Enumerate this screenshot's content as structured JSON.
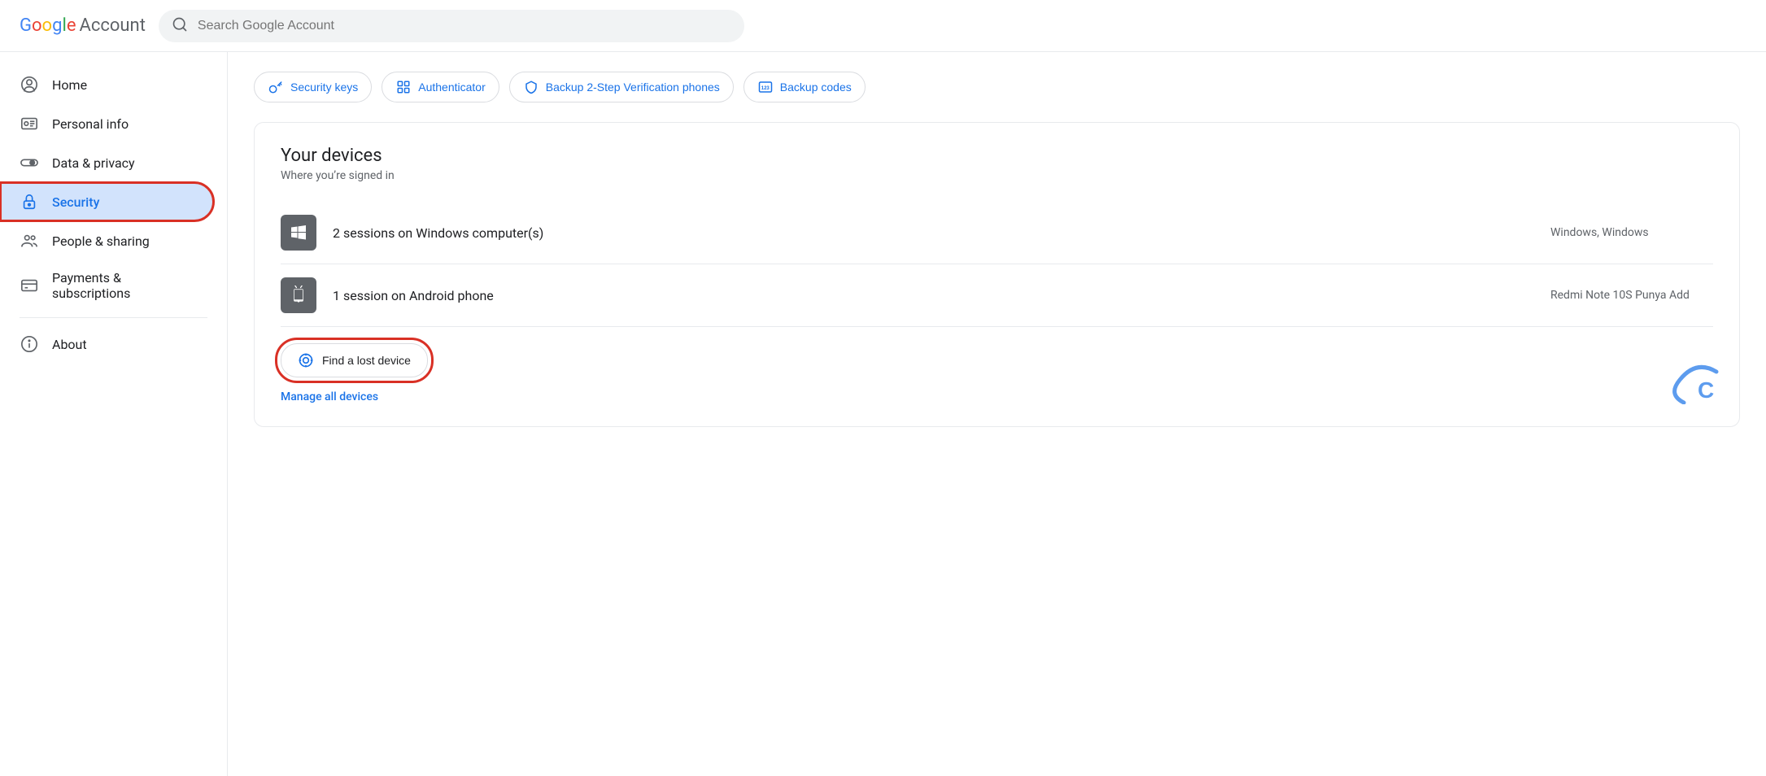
{
  "header": {
    "logo_google": "Google",
    "logo_account": "Account",
    "search_placeholder": "Search Google Account"
  },
  "sidebar": {
    "items": [
      {
        "id": "home",
        "label": "Home",
        "icon": "person-circle-icon"
      },
      {
        "id": "personal-info",
        "label": "Personal info",
        "icon": "id-card-icon"
      },
      {
        "id": "data-privacy",
        "label": "Data & privacy",
        "icon": "toggle-icon"
      },
      {
        "id": "security",
        "label": "Security",
        "icon": "lock-icon",
        "active": true
      },
      {
        "id": "people-sharing",
        "label": "People & sharing",
        "icon": "people-icon"
      },
      {
        "id": "payments",
        "label": "Payments & subscriptions",
        "icon": "card-icon"
      },
      {
        "id": "about",
        "label": "About",
        "icon": "info-icon"
      }
    ]
  },
  "chips": [
    {
      "id": "security-keys",
      "label": "Security keys",
      "icon": "key-icon"
    },
    {
      "id": "authenticator",
      "label": "Authenticator",
      "icon": "grid-icon"
    },
    {
      "id": "backup-2step",
      "label": "Backup 2-Step Verification phones",
      "icon": "shield-icon"
    },
    {
      "id": "backup-codes",
      "label": "Backup codes",
      "icon": "123-icon"
    }
  ],
  "your_devices": {
    "title": "Your devices",
    "subtitle": "Where you’re signed in",
    "devices": [
      {
        "id": "windows-device",
        "label": "2 sessions on Windows computer(s)",
        "detail": "Windows, Windows",
        "icon_type": "windows"
      },
      {
        "id": "android-device",
        "label": "1 session on Android phone",
        "detail": "Redmi Note 10S Punya Add",
        "icon_type": "android"
      }
    ],
    "find_button": "Find a lost device",
    "manage_link": "Manage all devices"
  }
}
